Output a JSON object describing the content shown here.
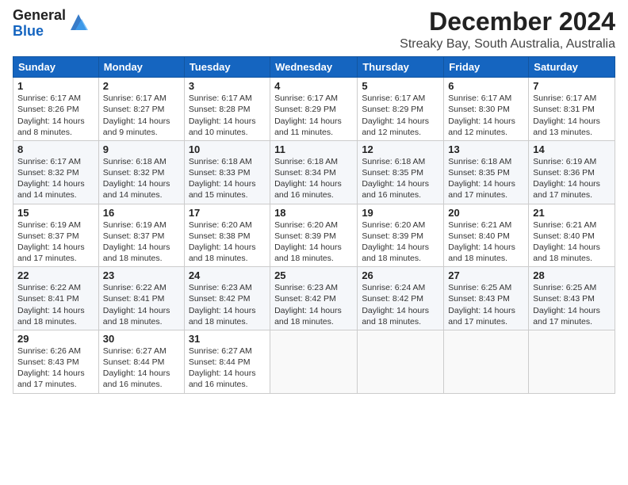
{
  "header": {
    "logo_general": "General",
    "logo_blue": "Blue",
    "month_title": "December 2024",
    "location": "Streaky Bay, South Australia, Australia"
  },
  "days_of_week": [
    "Sunday",
    "Monday",
    "Tuesday",
    "Wednesday",
    "Thursday",
    "Friday",
    "Saturday"
  ],
  "weeks": [
    [
      {
        "day": "1",
        "info": "Sunrise: 6:17 AM\nSunset: 8:26 PM\nDaylight: 14 hours and 8 minutes."
      },
      {
        "day": "2",
        "info": "Sunrise: 6:17 AM\nSunset: 8:27 PM\nDaylight: 14 hours and 9 minutes."
      },
      {
        "day": "3",
        "info": "Sunrise: 6:17 AM\nSunset: 8:28 PM\nDaylight: 14 hours and 10 minutes."
      },
      {
        "day": "4",
        "info": "Sunrise: 6:17 AM\nSunset: 8:29 PM\nDaylight: 14 hours and 11 minutes."
      },
      {
        "day": "5",
        "info": "Sunrise: 6:17 AM\nSunset: 8:29 PM\nDaylight: 14 hours and 12 minutes."
      },
      {
        "day": "6",
        "info": "Sunrise: 6:17 AM\nSunset: 8:30 PM\nDaylight: 14 hours and 12 minutes."
      },
      {
        "day": "7",
        "info": "Sunrise: 6:17 AM\nSunset: 8:31 PM\nDaylight: 14 hours and 13 minutes."
      }
    ],
    [
      {
        "day": "8",
        "info": "Sunrise: 6:17 AM\nSunset: 8:32 PM\nDaylight: 14 hours and 14 minutes."
      },
      {
        "day": "9",
        "info": "Sunrise: 6:18 AM\nSunset: 8:32 PM\nDaylight: 14 hours and 14 minutes."
      },
      {
        "day": "10",
        "info": "Sunrise: 6:18 AM\nSunset: 8:33 PM\nDaylight: 14 hours and 15 minutes."
      },
      {
        "day": "11",
        "info": "Sunrise: 6:18 AM\nSunset: 8:34 PM\nDaylight: 14 hours and 16 minutes."
      },
      {
        "day": "12",
        "info": "Sunrise: 6:18 AM\nSunset: 8:35 PM\nDaylight: 14 hours and 16 minutes."
      },
      {
        "day": "13",
        "info": "Sunrise: 6:18 AM\nSunset: 8:35 PM\nDaylight: 14 hours and 17 minutes."
      },
      {
        "day": "14",
        "info": "Sunrise: 6:19 AM\nSunset: 8:36 PM\nDaylight: 14 hours and 17 minutes."
      }
    ],
    [
      {
        "day": "15",
        "info": "Sunrise: 6:19 AM\nSunset: 8:37 PM\nDaylight: 14 hours and 17 minutes."
      },
      {
        "day": "16",
        "info": "Sunrise: 6:19 AM\nSunset: 8:37 PM\nDaylight: 14 hours and 18 minutes."
      },
      {
        "day": "17",
        "info": "Sunrise: 6:20 AM\nSunset: 8:38 PM\nDaylight: 14 hours and 18 minutes."
      },
      {
        "day": "18",
        "info": "Sunrise: 6:20 AM\nSunset: 8:39 PM\nDaylight: 14 hours and 18 minutes."
      },
      {
        "day": "19",
        "info": "Sunrise: 6:20 AM\nSunset: 8:39 PM\nDaylight: 14 hours and 18 minutes."
      },
      {
        "day": "20",
        "info": "Sunrise: 6:21 AM\nSunset: 8:40 PM\nDaylight: 14 hours and 18 minutes."
      },
      {
        "day": "21",
        "info": "Sunrise: 6:21 AM\nSunset: 8:40 PM\nDaylight: 14 hours and 18 minutes."
      }
    ],
    [
      {
        "day": "22",
        "info": "Sunrise: 6:22 AM\nSunset: 8:41 PM\nDaylight: 14 hours and 18 minutes."
      },
      {
        "day": "23",
        "info": "Sunrise: 6:22 AM\nSunset: 8:41 PM\nDaylight: 14 hours and 18 minutes."
      },
      {
        "day": "24",
        "info": "Sunrise: 6:23 AM\nSunset: 8:42 PM\nDaylight: 14 hours and 18 minutes."
      },
      {
        "day": "25",
        "info": "Sunrise: 6:23 AM\nSunset: 8:42 PM\nDaylight: 14 hours and 18 minutes."
      },
      {
        "day": "26",
        "info": "Sunrise: 6:24 AM\nSunset: 8:42 PM\nDaylight: 14 hours and 18 minutes."
      },
      {
        "day": "27",
        "info": "Sunrise: 6:25 AM\nSunset: 8:43 PM\nDaylight: 14 hours and 17 minutes."
      },
      {
        "day": "28",
        "info": "Sunrise: 6:25 AM\nSunset: 8:43 PM\nDaylight: 14 hours and 17 minutes."
      }
    ],
    [
      {
        "day": "29",
        "info": "Sunrise: 6:26 AM\nSunset: 8:43 PM\nDaylight: 14 hours and 17 minutes."
      },
      {
        "day": "30",
        "info": "Sunrise: 6:27 AM\nSunset: 8:44 PM\nDaylight: 14 hours and 16 minutes."
      },
      {
        "day": "31",
        "info": "Sunrise: 6:27 AM\nSunset: 8:44 PM\nDaylight: 14 hours and 16 minutes."
      },
      null,
      null,
      null,
      null
    ]
  ]
}
